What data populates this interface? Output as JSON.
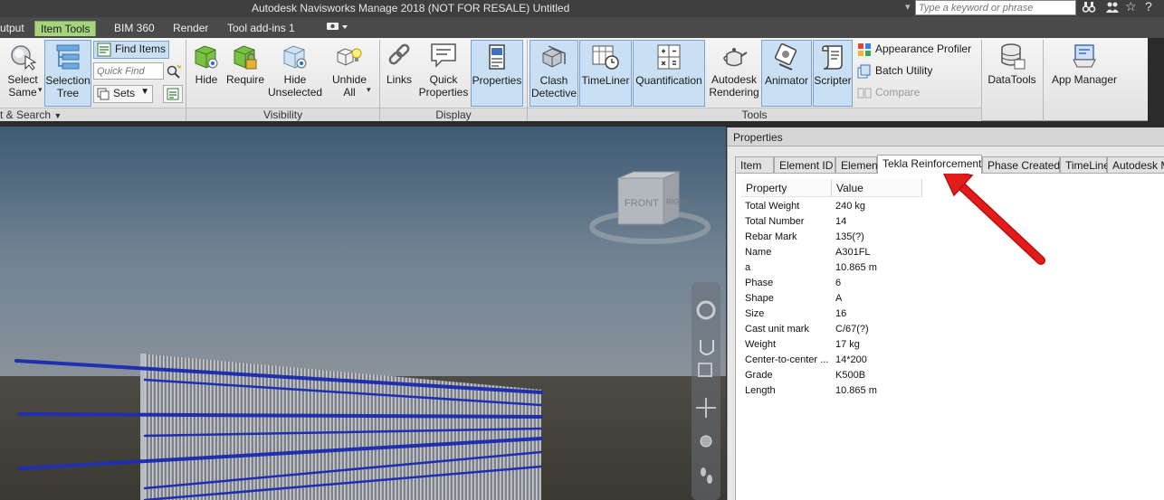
{
  "titlebar": {
    "title": "Autodesk Navisworks Manage 2018 (NOT FOR RESALE)    Untitled",
    "search_placeholder": "Type a keyword or phrase"
  },
  "ribbon_tabs": [
    {
      "label": "utput"
    },
    {
      "label": "Item Tools",
      "active": true
    },
    {
      "label": "BIM 360"
    },
    {
      "label": "Render"
    },
    {
      "label": "Tool add-ins 1"
    }
  ],
  "ribbon": {
    "select_search": {
      "select_same": "Select\nSame",
      "selection_tree": "Selection\nTree",
      "find_items": "Find Items",
      "quick_find_placeholder": "Quick Find",
      "sets": "Sets",
      "panel_label": "t & Search"
    },
    "visibility": {
      "hide": "Hide",
      "require": "Require",
      "hide_unselected": "Hide\nUnselected",
      "unhide_all": "Unhide\nAll",
      "panel_label": "Visibility"
    },
    "display": {
      "links": "Links",
      "quick_properties": "Quick\nProperties",
      "properties": "Properties",
      "panel_label": "Display"
    },
    "tools": {
      "clash_detective": "Clash\nDetective",
      "timeliner": "TimeLiner",
      "quantification": "Quantification",
      "autodesk_rendering": "Autodesk\nRendering",
      "animator": "Animator",
      "scripter": "Scripter",
      "appearance_profiler": "Appearance Profiler",
      "batch_utility": "Batch Utility",
      "compare": "Compare",
      "panel_label": "Tools"
    },
    "datatools": "DataTools",
    "app_manager": "App Manager"
  },
  "viewcube": {
    "front": "FRONT",
    "right": "RIGHT"
  },
  "properties": {
    "title": "Properties",
    "tabs": [
      {
        "label": "Item"
      },
      {
        "label": "Element ID"
      },
      {
        "label": "Element"
      },
      {
        "label": "Tekla Reinforcement",
        "active": true
      },
      {
        "label": "Phase Created"
      },
      {
        "label": "TimeLiner"
      },
      {
        "label": "Autodesk Ma"
      }
    ],
    "columns": [
      "Property",
      "Value"
    ],
    "rows": [
      {
        "property": "Total Weight",
        "value": "240 kg"
      },
      {
        "property": "Total Number",
        "value": "14"
      },
      {
        "property": "Rebar Mark",
        "value": "135(?)"
      },
      {
        "property": "Name",
        "value": "A301FL"
      },
      {
        "property": "a",
        "value": "10.865 m"
      },
      {
        "property": "Phase",
        "value": "6"
      },
      {
        "property": "Shape",
        "value": "A"
      },
      {
        "property": "Size",
        "value": "16"
      },
      {
        "property": "Cast unit mark",
        "value": "C/67(?)"
      },
      {
        "property": "Weight",
        "value": "17 kg"
      },
      {
        "property": "Center-to-center ...",
        "value": "14*200"
      },
      {
        "property": "Grade",
        "value": "K500B"
      },
      {
        "property": "Length",
        "value": "10.865 m"
      }
    ]
  },
  "colors": {
    "active_tab": "#a6d37e",
    "selected_button": "#c9dff3",
    "annotation_arrow": "#e31b1b",
    "rebar_blue": "#1f2fb0"
  }
}
